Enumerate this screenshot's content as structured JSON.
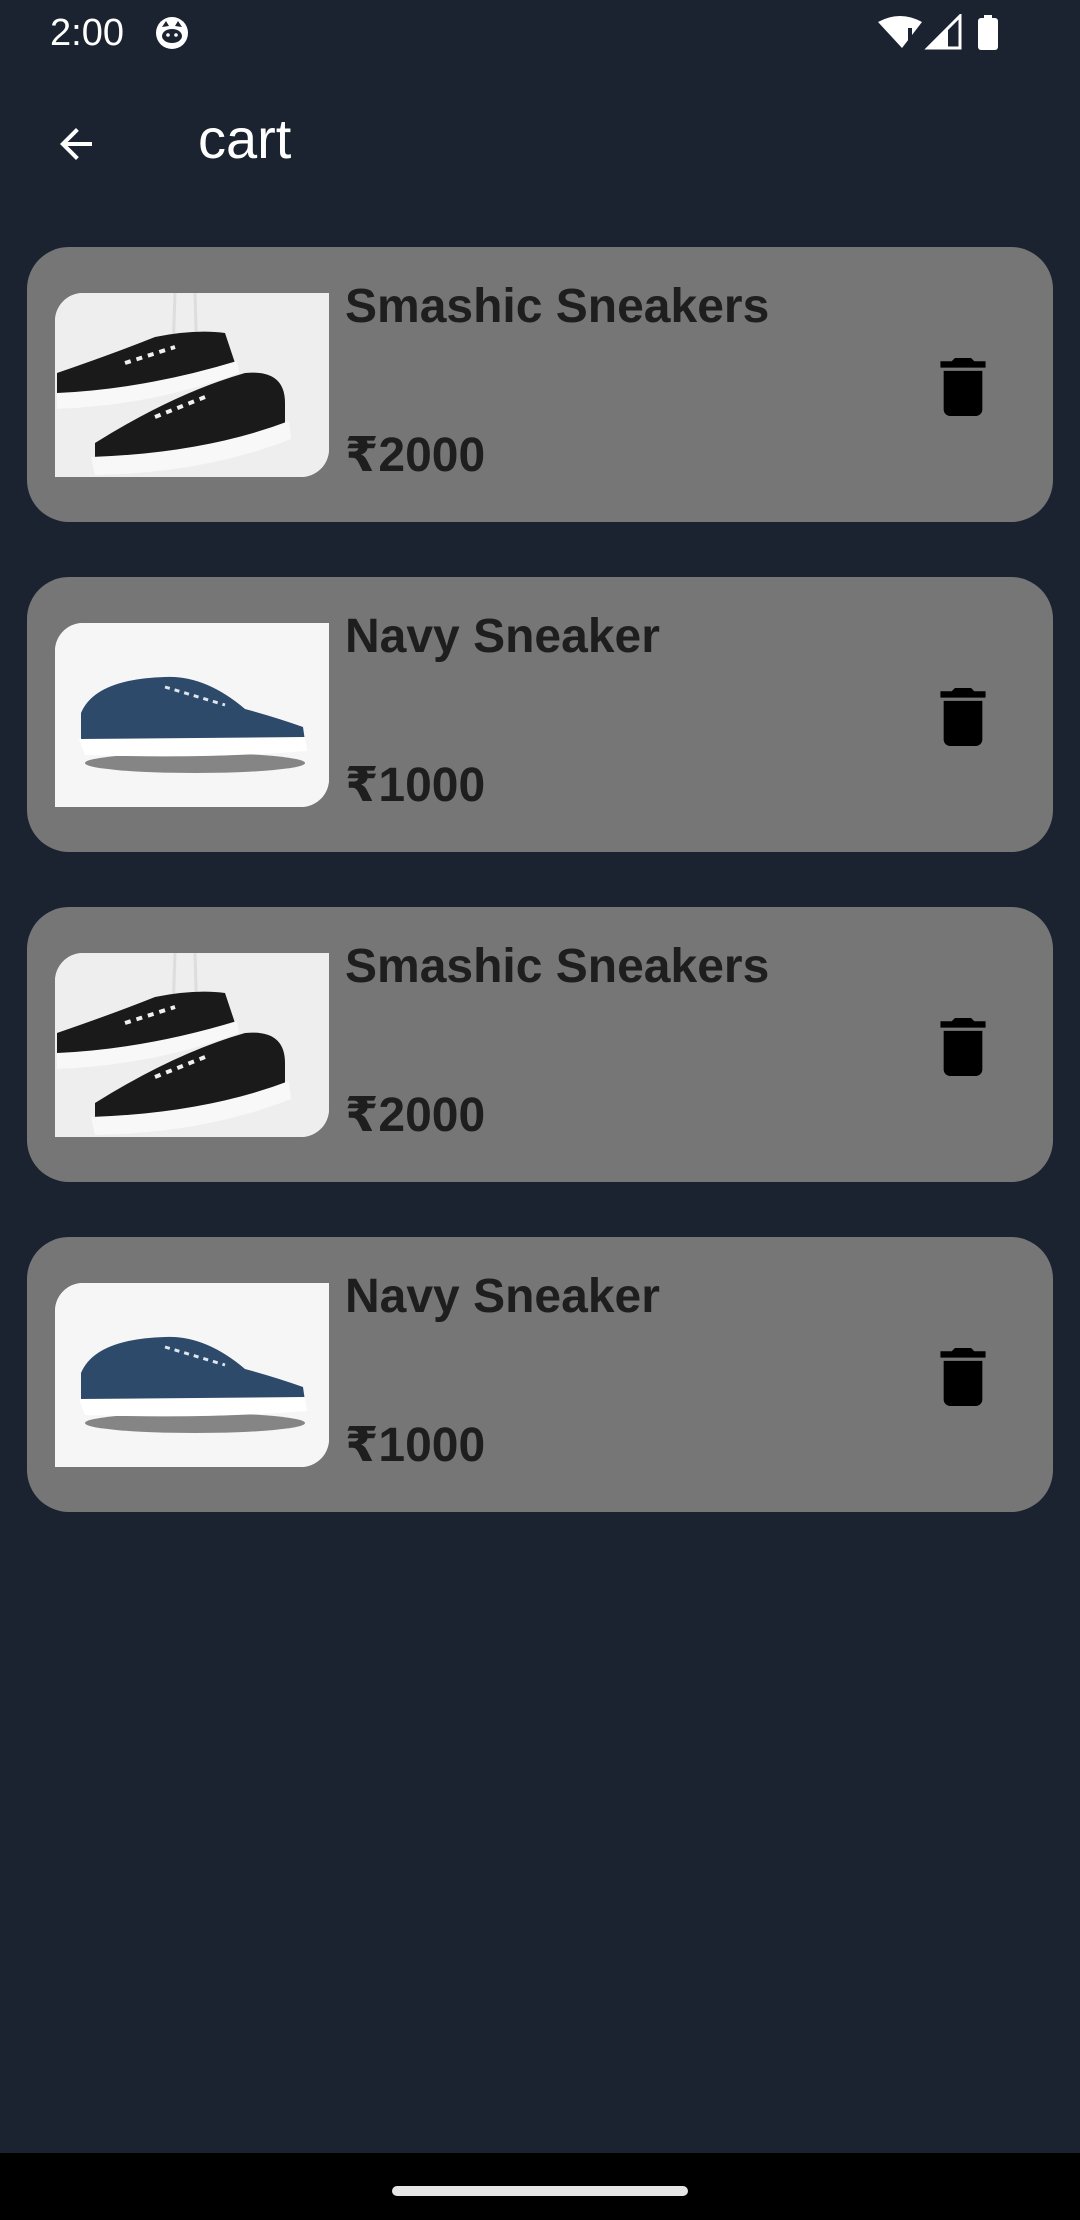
{
  "status_bar": {
    "time": "2:00",
    "icons": [
      "cat-face-icon",
      "wifi-alert-icon",
      "cell-signal-icon",
      "battery-icon"
    ]
  },
  "app_bar": {
    "back_icon": "arrow-left-icon",
    "title": "cart"
  },
  "cart": {
    "items": [
      {
        "name": "Smashic Sneakers",
        "price": "₹2000",
        "image": "black-sneakers-pair",
        "delete_icon": "trash-icon"
      },
      {
        "name": "Navy Sneaker",
        "price": "₹1000",
        "image": "navy-sneaker",
        "delete_icon": "trash-icon"
      },
      {
        "name": "Smashic Sneakers",
        "price": "₹2000",
        "image": "black-sneakers-pair",
        "delete_icon": "trash-icon"
      },
      {
        "name": "Navy Sneaker",
        "price": "₹1000",
        "image": "navy-sneaker",
        "delete_icon": "trash-icon"
      }
    ]
  },
  "colors": {
    "background": "#1c2330",
    "card": "#767676",
    "card_text": "#1e1e1e",
    "navy_shoe": "#2e4a6b"
  }
}
